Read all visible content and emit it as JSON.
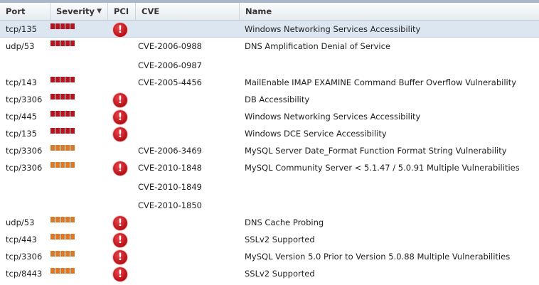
{
  "columns": [
    "Port",
    "Severity",
    "PCI",
    "CVE",
    "Name"
  ],
  "severity_colors": {
    "high": "#b4141e",
    "medium": "#d87a2a"
  },
  "rows": [
    {
      "port": "tcp/135",
      "severity": "high",
      "pci": true,
      "cves": [],
      "name": "Windows Networking Services Accessibility",
      "selected": true
    },
    {
      "port": "udp/53",
      "severity": "high",
      "pci": false,
      "cves": [
        "CVE-2006-0988",
        "CVE-2006-0987"
      ],
      "name": "DNS Amplification Denial of Service"
    },
    {
      "port": "tcp/143",
      "severity": "high",
      "pci": false,
      "cves": [
        "CVE-2005-4456"
      ],
      "name": "MailEnable IMAP EXAMINE Command Buffer Overflow Vulnerability"
    },
    {
      "port": "tcp/3306",
      "severity": "high",
      "pci": true,
      "cves": [],
      "name": "DB Accessibility"
    },
    {
      "port": "tcp/445",
      "severity": "high",
      "pci": true,
      "cves": [],
      "name": "Windows Networking Services Accessibility"
    },
    {
      "port": "tcp/135",
      "severity": "high",
      "pci": true,
      "cves": [],
      "name": "Windows DCE Service Accessibility"
    },
    {
      "port": "tcp/3306",
      "severity": "medium",
      "pci": false,
      "cves": [
        "CVE-2006-3469"
      ],
      "name": "MySQL Server Date_Format Function Format String Vulnerability"
    },
    {
      "port": "tcp/3306",
      "severity": "medium",
      "pci": true,
      "cves": [
        "CVE-2010-1848",
        "CVE-2010-1849",
        "CVE-2010-1850"
      ],
      "name": "MySQL Community Server < 5.1.47 / 5.0.91 Multiple Vulnerabilities"
    },
    {
      "port": "udp/53",
      "severity": "medium",
      "pci": true,
      "cves": [],
      "name": "DNS Cache Probing"
    },
    {
      "port": "tcp/443",
      "severity": "medium",
      "pci": true,
      "cves": [],
      "name": "SSLv2 Supported"
    },
    {
      "port": "tcp/3306",
      "severity": "medium",
      "pci": true,
      "cves": [],
      "name": "MySQL Version 5.0 Prior to Version 5.0.88 Multiple Vulnerabilities"
    },
    {
      "port": "tcp/8443",
      "severity": "medium",
      "pci": true,
      "cves": [],
      "name": "SSLv2 Supported"
    }
  ]
}
